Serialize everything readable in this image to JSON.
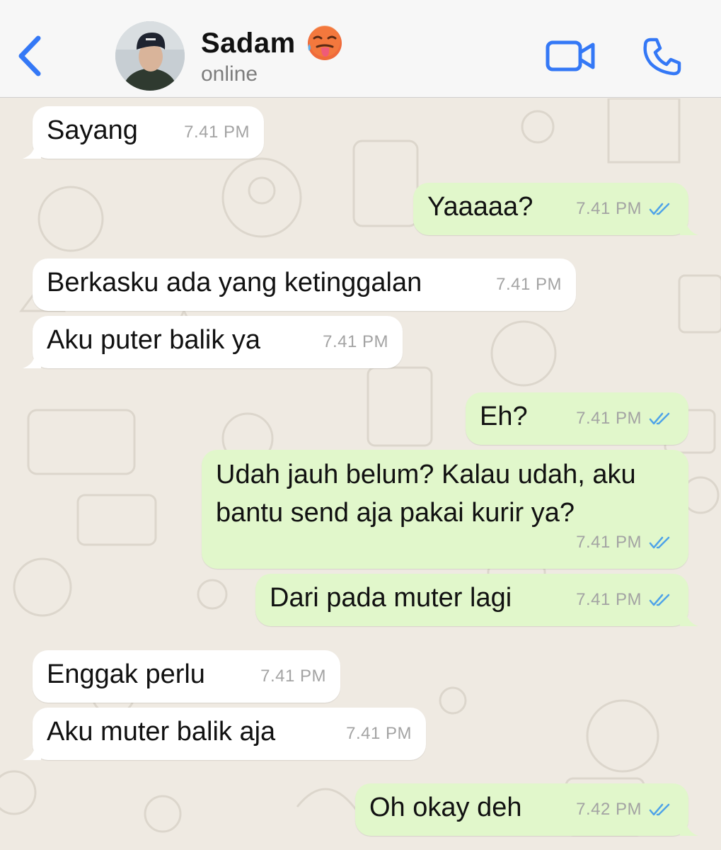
{
  "header": {
    "contact_name": "Sadam",
    "status": "online",
    "emoji": "hot-face-emoji"
  },
  "colors": {
    "accent": "#3478f6",
    "incoming_bubble": "#ffffff",
    "outgoing_bubble": "#e1f7cb",
    "read_tick": "#4fa3e8",
    "wallpaper": "#efeae2"
  },
  "messages": [
    {
      "direction": "in",
      "text": "Sayang",
      "time": "7.41 PM"
    },
    {
      "direction": "out",
      "text": "Yaaaaa?",
      "time": "7.41 PM",
      "read": true
    },
    {
      "direction": "in",
      "text": "Berkasku ada yang ketinggalan",
      "time": "7.41 PM"
    },
    {
      "direction": "in",
      "text": "Aku puter balik ya",
      "time": "7.41 PM"
    },
    {
      "direction": "out",
      "text": "Eh?",
      "time": "7.41 PM",
      "read": true
    },
    {
      "direction": "out",
      "text_line1": "Udah jauh belum? Kalau udah, aku",
      "text_line2": "bantu send aja pakai kurir ya?",
      "time": "7.41 PM",
      "read": true
    },
    {
      "direction": "out",
      "text": "Dari pada muter lagi",
      "time": "7.41 PM",
      "read": true
    },
    {
      "direction": "in",
      "text": "Enggak perlu",
      "time": "7.41 PM"
    },
    {
      "direction": "in",
      "text": "Aku muter balik aja",
      "time": "7.41 PM"
    },
    {
      "direction": "out",
      "text": "Oh okay deh",
      "time": "7.42 PM",
      "read": true
    }
  ]
}
